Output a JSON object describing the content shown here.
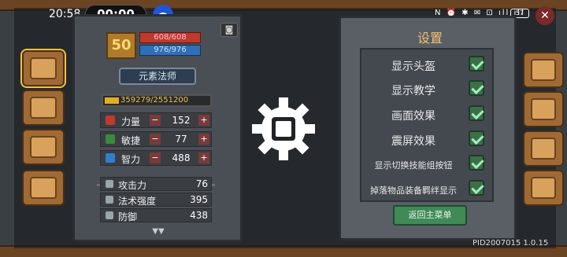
{
  "status_bar": {
    "time": "20:58",
    "timer": "00:00",
    "icons": "N ⏰ ✱ ✉ ⊡ ıll ıll",
    "battery": "57"
  },
  "stats_panel": {
    "level": "50",
    "hp": "608/608",
    "mp": "976/976",
    "class_name": "元素法师",
    "exp": "359279/2551200",
    "exp_fraction": 0.14,
    "attributes": [
      {
        "name": "力量",
        "value": "152",
        "color": "#c0392b"
      },
      {
        "name": "敏捷",
        "value": "77",
        "color": "#3b8a3b"
      },
      {
        "name": "智力",
        "value": "488",
        "color": "#2f7fd0"
      }
    ],
    "combat_stats": [
      {
        "name": "攻击力",
        "value": "76"
      },
      {
        "name": "法术强度",
        "value": "395"
      },
      {
        "name": "防御",
        "value": "438"
      }
    ]
  },
  "settings": {
    "title": "设置",
    "options": [
      {
        "label": "显示头盔",
        "checked": true
      },
      {
        "label": "显示教学",
        "checked": true
      },
      {
        "label": "画面效果",
        "checked": true
      },
      {
        "label": "震屏效果",
        "checked": true
      },
      {
        "label": "显示切换技能组按钮",
        "checked": true
      },
      {
        "label": "掉落物品装备羁绊显示",
        "checked": true
      }
    ],
    "return_button": "返回主菜单"
  },
  "version": "PID2007015 1.0.15",
  "colors": {
    "accent_gold": "#f0c070",
    "check_green": "#3d6e4a",
    "button_green": "#3f8a57"
  }
}
